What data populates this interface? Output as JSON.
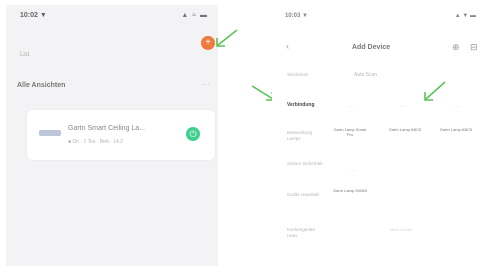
{
  "left_screen": {
    "status_time": "10:02 ▼",
    "status_icons": "▲ ≈ ▬",
    "nav_text": "List",
    "add_icon": "+",
    "section_title": "Alle Ansichten",
    "section_action": "···",
    "device": {
      "name": "Gartn Smart Ceiling La...",
      "meta": "■ On · 1 Tes · Bett · 14.2",
      "power_icon": "⏻"
    }
  },
  "right_screen": {
    "status_time": "10:03 ▼",
    "status_icons": "▲ ▼ ▬",
    "back_icon": "‹",
    "title": "Add Device",
    "scan_icon": "⊕",
    "more_icon": "⊟",
    "top_tab": "Auto Scan",
    "categories": [
      "Steckdose",
      "Verbindung",
      "Beleuchtung Lampe",
      "Sensor Sicherheit",
      "Große Haushalt",
      "Küchengeräte Haus"
    ],
    "items": [
      "Gartn Lamp Smart Pro",
      "Gartn Lamp ABC5",
      "Gartn Lamp ABC5",
      "Gartn Lamp 2000N"
    ],
    "faint_labels": [
      "----",
      "----",
      "----",
      "----",
      "----"
    ],
    "footer_label": "Mehr Geräte"
  }
}
